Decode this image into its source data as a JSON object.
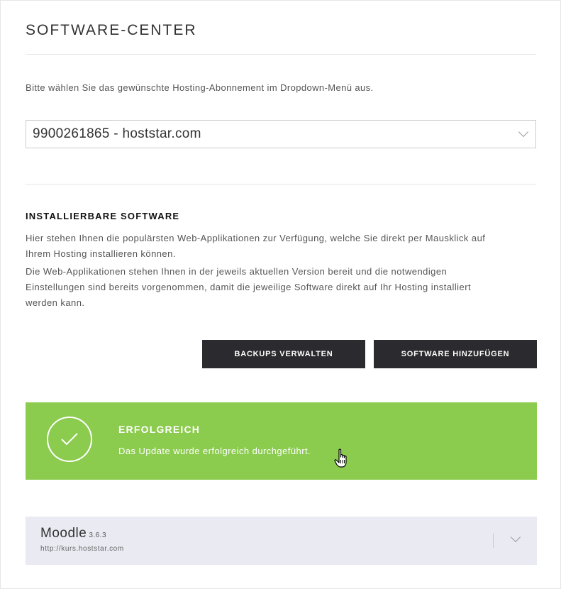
{
  "page": {
    "title": "SOFTWARE-CENTER",
    "intro": "Bitte wählen Sie das gewünschte Hosting-Abonnement im Dropdown-Menü aus."
  },
  "subscription_select": {
    "value": "9900261865 - hoststar.com",
    "icon": "chevron-down-icon"
  },
  "installable": {
    "heading": "INSTALLIERBARE SOFTWARE",
    "desc_1_line_1": "Hier stehen Ihnen die populärsten Web-Applikationen zur Verfügung, welche Sie direkt per Mausklick auf",
    "desc_1_line_2": "Ihrem Hosting installieren können.",
    "desc_2_line_1": "Die Web-Applikationen stehen Ihnen in der jeweils aktuellen Version bereit und die notwendigen",
    "desc_2_line_2": "Einstellungen sind bereits vorgenommen, damit die jeweilige Software direkt auf Ihr Hosting installiert",
    "desc_2_line_3": "werden kann."
  },
  "actions": {
    "backups_label": "BACKUPS VERWALTEN",
    "add_software_label": "SOFTWARE HINZUFÜGEN"
  },
  "notification": {
    "title": "ERFOLGREICH",
    "message": "Das Update wurde erfolgreich durchgeführt.",
    "color": "#8bcb4e",
    "icon": "checkmark-icon"
  },
  "installed_apps": [
    {
      "name": "Moodle",
      "version": "3.6.3",
      "url": "http://kurs.hoststar.com"
    }
  ],
  "colors": {
    "button_bg": "#2b2b2f",
    "app_panel_bg": "#e9eaf2"
  }
}
